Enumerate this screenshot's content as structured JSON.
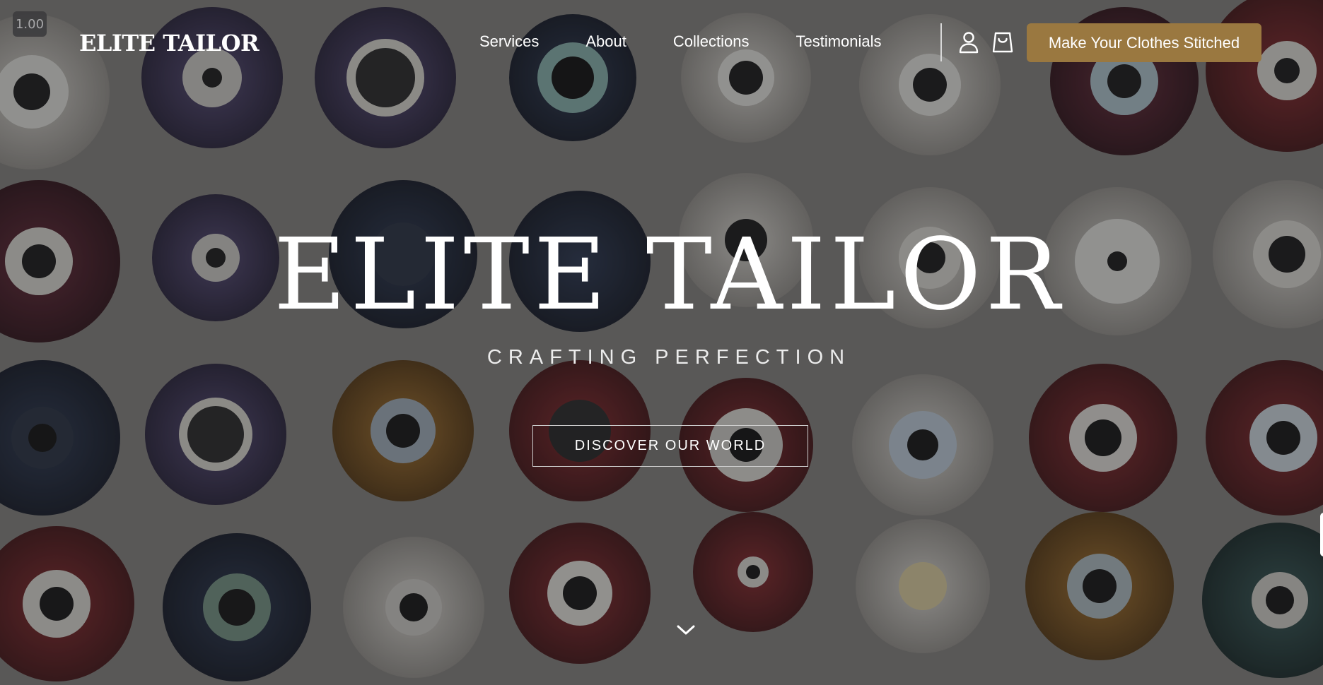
{
  "zoom_level": "1.00",
  "header": {
    "logo": "ELITE TAILOR",
    "nav": [
      {
        "label": "Services"
      },
      {
        "label": "About"
      },
      {
        "label": "Collections"
      },
      {
        "label": "Testimonials"
      }
    ],
    "icons": {
      "account": "user-icon",
      "cart": "shopping-bag-icon"
    },
    "cta_label": "Make Your Clothes Stitched"
  },
  "hero": {
    "title": "ELITE TAILOR",
    "subtitle": "CRAFTING PERFECTION",
    "button_label": "DISCOVER OUR WORLD",
    "scroll_icon": "chevron-down-icon"
  },
  "colors": {
    "accent": "#9a7840",
    "text": "#ffffff",
    "overlay": "#1c1c1e"
  }
}
